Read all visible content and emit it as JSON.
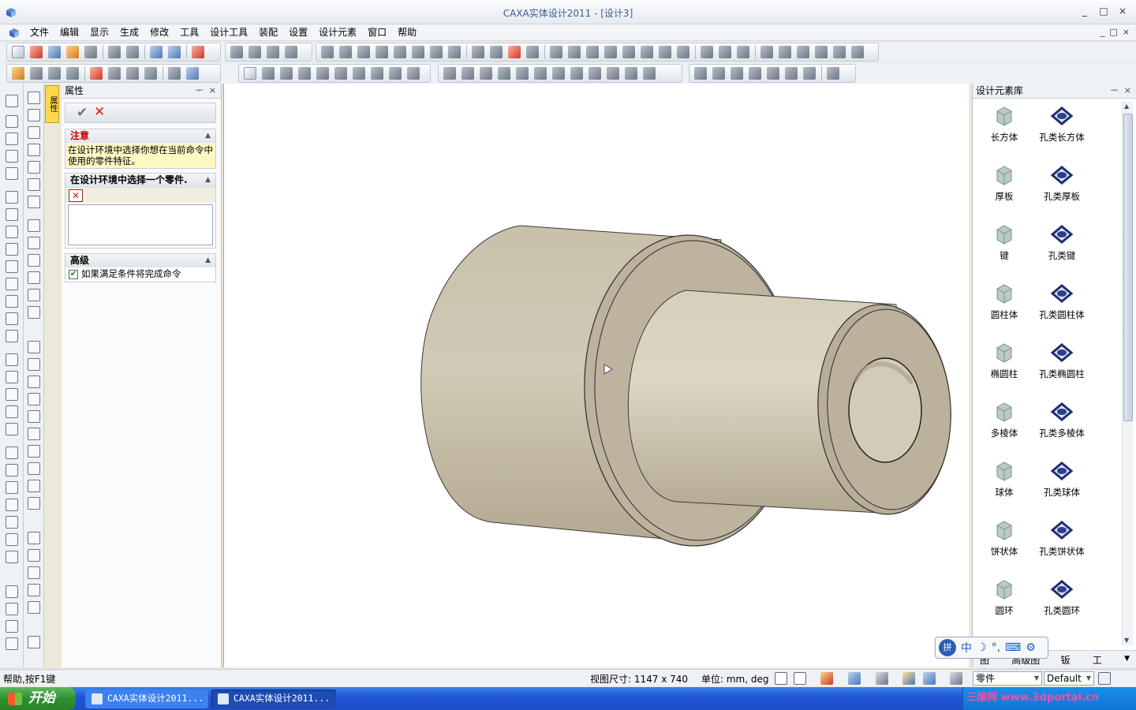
{
  "window": {
    "title": "CAXA实体设计2011 - [设计3]",
    "controls": [
      "_",
      "□",
      "×"
    ]
  },
  "menubar": {
    "items": [
      "文件",
      "编辑",
      "显示",
      "生成",
      "修改",
      "工具",
      "设计工具",
      "装配",
      "设置",
      "设计元素",
      "窗口",
      "帮助"
    ],
    "mdi_controls": [
      "_",
      "□",
      "×"
    ]
  },
  "side_tab": {
    "label": "属性"
  },
  "property_panel": {
    "title": "属性",
    "controls": [
      "ᅮ",
      "×"
    ],
    "ok_symbol": "✔",
    "cancel_symbol": "✕",
    "note_section": {
      "header": "注意",
      "text": "在设计环境中选择你想在当前命令中使用的零件特征。"
    },
    "select_section": {
      "header": "在设计环境中选择一个零件."
    },
    "advanced_section": {
      "header": "高级",
      "checkbox_label": "如果满足条件将完成命令",
      "checked": true
    }
  },
  "library": {
    "title": "设计元素库",
    "items": [
      {
        "label": "长方体",
        "icon": "box-icon"
      },
      {
        "label": "孔类长方体",
        "icon": "hole-box-icon"
      },
      {
        "label": "厚板",
        "icon": "plate-icon"
      },
      {
        "label": "孔类厚板",
        "icon": "hole-plate-icon"
      },
      {
        "label": "键",
        "icon": "key-icon"
      },
      {
        "label": "孔类键",
        "icon": "hole-key-icon"
      },
      {
        "label": "圆柱体",
        "icon": "cylinder-icon"
      },
      {
        "label": "孔类圆柱体",
        "icon": "hole-cylinder-icon"
      },
      {
        "label": "椭圆柱",
        "icon": "elliptic-cylinder-icon"
      },
      {
        "label": "孔类椭圆柱",
        "icon": "hole-elliptic-cylinder-icon"
      },
      {
        "label": "多棱体",
        "icon": "prism-icon"
      },
      {
        "label": "孔类多棱体",
        "icon": "hole-prism-icon"
      },
      {
        "label": "球体",
        "icon": "sphere-icon"
      },
      {
        "label": "孔类球体",
        "icon": "hole-sphere-icon"
      },
      {
        "label": "饼状体",
        "icon": "pie-icon"
      },
      {
        "label": "孔类饼状体",
        "icon": "hole-pie-icon"
      },
      {
        "label": "圆环",
        "icon": "torus-icon"
      },
      {
        "label": "孔类圆环",
        "icon": "hole-torus-icon"
      }
    ],
    "tabs": [
      "图素",
      "高级图素",
      "钣金",
      "工具"
    ]
  },
  "ime_bar": {
    "items": [
      "中",
      "☽",
      "°,",
      "⌨",
      "⚙"
    ]
  },
  "statusbar": {
    "help": "帮助,按F1键",
    "view_size": "视图尺寸: 1147 x  740",
    "units": "单位: mm, deg",
    "mode_combo": "零件",
    "style_combo": "Default"
  },
  "taskbar": {
    "start": "开始",
    "items": [
      "CAXA实体设计2011...",
      "CAXA实体设计2011..."
    ],
    "tray_text": "三维网 www.3dportal.cn"
  },
  "colors": {
    "part_body": "#c8c0ac",
    "accent_blue": "#2157d4"
  }
}
